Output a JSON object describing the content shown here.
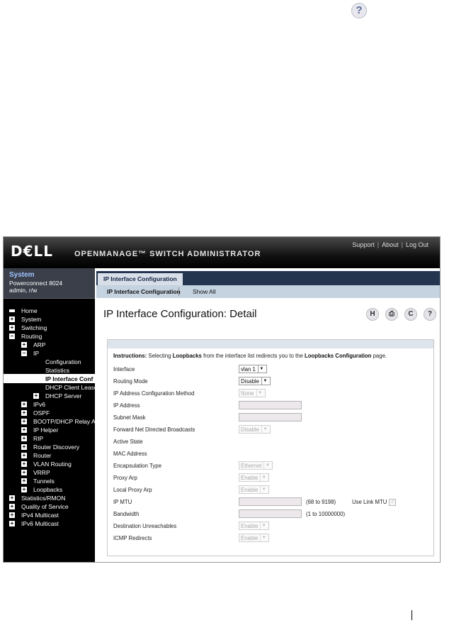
{
  "help_top_glyph": "?",
  "header": {
    "logo": "D€LL",
    "title": "OPENMANAGE™ SWITCH ADMINISTRATOR",
    "links": [
      "Support",
      "About",
      "Log Out"
    ],
    "link_sep": "|"
  },
  "system": {
    "title": "System",
    "model": "Powerconnect 8024",
    "user": "admin, r/w"
  },
  "tree": [
    {
      "label": "Home",
      "level": 0,
      "toggle": "",
      "selected": false
    },
    {
      "label": "System",
      "level": 0,
      "toggle": "+",
      "selected": false
    },
    {
      "label": "Switching",
      "level": 0,
      "toggle": "+",
      "selected": false
    },
    {
      "label": "Routing",
      "level": 0,
      "toggle": "−",
      "selected": false
    },
    {
      "label": "ARP",
      "level": 1,
      "toggle": "+",
      "selected": false
    },
    {
      "label": "IP",
      "level": 1,
      "toggle": "−",
      "selected": false
    },
    {
      "label": "Configuration",
      "level": 2,
      "toggle": "",
      "selected": false
    },
    {
      "label": "Statistics",
      "level": 2,
      "toggle": "",
      "selected": false
    },
    {
      "label": "IP Interface Conf",
      "level": 2,
      "toggle": "",
      "selected": true
    },
    {
      "label": "DHCP Client Lease",
      "level": 2,
      "toggle": "",
      "selected": false
    },
    {
      "label": "DHCP Server",
      "level": 2,
      "toggle": "+",
      "selected": false
    },
    {
      "label": "IPv6",
      "level": 1,
      "toggle": "+",
      "selected": false
    },
    {
      "label": "OSPF",
      "level": 1,
      "toggle": "+",
      "selected": false
    },
    {
      "label": "BOOTP/DHCP Relay Age",
      "level": 1,
      "toggle": "+",
      "selected": false
    },
    {
      "label": "IP Helper",
      "level": 1,
      "toggle": "+",
      "selected": false
    },
    {
      "label": "RIP",
      "level": 1,
      "toggle": "+",
      "selected": false
    },
    {
      "label": "Router Discovery",
      "level": 1,
      "toggle": "+",
      "selected": false
    },
    {
      "label": "Router",
      "level": 1,
      "toggle": "+",
      "selected": false
    },
    {
      "label": "VLAN Routing",
      "level": 1,
      "toggle": "+",
      "selected": false
    },
    {
      "label": "VRRP",
      "level": 1,
      "toggle": "+",
      "selected": false
    },
    {
      "label": "Tunnels",
      "level": 1,
      "toggle": "+",
      "selected": false
    },
    {
      "label": "Loopbacks",
      "level": 1,
      "toggle": "+",
      "selected": false
    },
    {
      "label": "Statistics/RMON",
      "level": 0,
      "toggle": "+",
      "selected": false
    },
    {
      "label": "Quality of Service",
      "level": 0,
      "toggle": "+",
      "selected": false
    },
    {
      "label": "IPv4 Multicast",
      "level": 0,
      "toggle": "+",
      "selected": false
    },
    {
      "label": "IPv6 Multicast",
      "level": 0,
      "toggle": "+",
      "selected": false
    }
  ],
  "tab": "IP Interface Configuration",
  "subtabs": [
    "IP Interface Configuration",
    "Show All"
  ],
  "page_title": "IP Interface Configuration: Detail",
  "actions": [
    {
      "name": "save-icon",
      "glyph": "H"
    },
    {
      "name": "print-icon",
      "glyph": "⎙"
    },
    {
      "name": "refresh-icon",
      "glyph": "C"
    },
    {
      "name": "help-icon",
      "glyph": "?"
    }
  ],
  "instructions": {
    "lead": "Instructions:",
    "t1": " Selecting ",
    "b1": "Loopbacks",
    "t2": " from the interface list redirects you to the ",
    "b2": "Loopbacks Configuration",
    "t3": " page."
  },
  "form": {
    "interface": {
      "label": "Interface",
      "value": "vlan 1"
    },
    "routing_mode": {
      "label": "Routing Mode",
      "value": "Disable"
    },
    "ip_method": {
      "label": "IP Address Configuration Method",
      "value": "None"
    },
    "ip_address": {
      "label": "IP Address",
      "value": ""
    },
    "subnet_mask": {
      "label": "Subnet Mask",
      "value": ""
    },
    "fwd_broadcasts": {
      "label": "Forward Net Directed Broadcasts",
      "value": "Disable"
    },
    "active_state": {
      "label": "Active State",
      "value": ""
    },
    "mac_address": {
      "label": "MAC Address",
      "value": ""
    },
    "encapsulation": {
      "label": "Encapsulation Type",
      "value": "Ethernet"
    },
    "proxy_arp": {
      "label": "Proxy Arp",
      "value": "Enable"
    },
    "local_proxy_arp": {
      "label": "Local Proxy Arp",
      "value": "Enable"
    },
    "ip_mtu": {
      "label": "IP MTU",
      "value": "",
      "hint": "(68 to 9198)",
      "link_label": "Use Link MTU"
    },
    "bandwidth": {
      "label": "Bandwidth",
      "value": "",
      "hint": "(1 to 10000000)"
    },
    "dest_unreach": {
      "label": "Destination Unreachables",
      "value": "Enable"
    },
    "icmp_redirects": {
      "label": "ICMP Redirects",
      "value": "Enable"
    }
  }
}
